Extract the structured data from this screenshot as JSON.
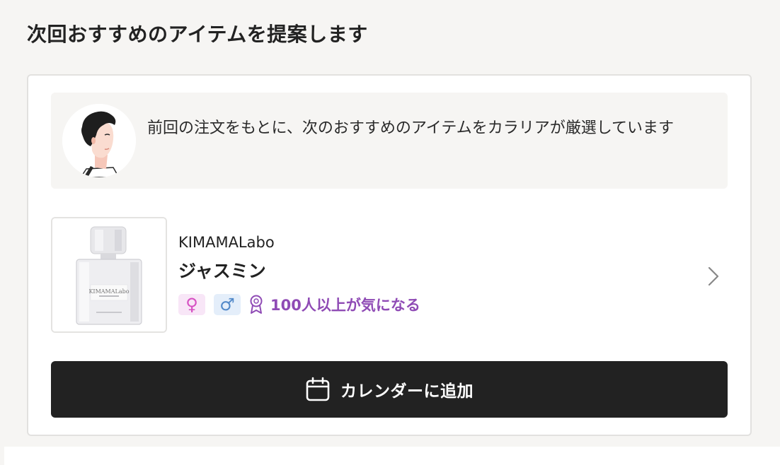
{
  "section": {
    "title": "次回おすすめのアイテムを提案します"
  },
  "advisor": {
    "message": "前回の注文をもとに、次のおすすめのアイテムをカラリアが厳選しています",
    "avatar_icon": "person-illustration-icon"
  },
  "product": {
    "brand": "KIMAMALabo",
    "name": "ジャスミン",
    "bottle_label": "KIMAMALabo",
    "tags": {
      "female_icon": "♀",
      "male_icon": "♂",
      "award_icon": "ribbon-award-icon",
      "popular_text": "100人以上が気になる"
    },
    "chevron_icon": "chevron-right-icon"
  },
  "actions": {
    "add_to_calendar_label": "カレンダーに追加",
    "calendar_icon": "calendar-icon"
  },
  "colors": {
    "page_bg": "#f6f5f3",
    "card_bg": "#ffffff",
    "button_bg": "#222222",
    "accent_purple": "#8f4bb5",
    "female_pink": "#d64fc2",
    "male_blue": "#5289c9"
  }
}
